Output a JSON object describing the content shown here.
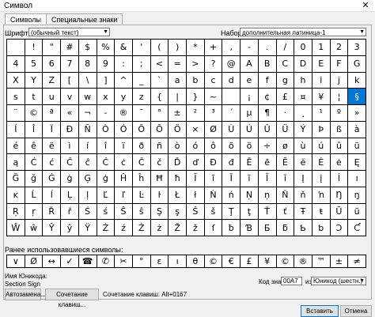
{
  "window": {
    "title": "Символ",
    "close_glyph": "✕"
  },
  "tabs": [
    {
      "label": "Символы"
    },
    {
      "label": "Специальные знаки"
    }
  ],
  "font": {
    "label": "Шрифт:",
    "value": "(обычный текст)"
  },
  "subset": {
    "label": "Набор:",
    "value": "дополнительная латиница-1"
  },
  "symbols": [
    [
      "",
      "!",
      "\"",
      "#",
      "$",
      "%",
      "&",
      "'",
      "(",
      ")",
      "*",
      "+",
      ",",
      "-",
      ".",
      "/",
      "0",
      "1",
      "2",
      "3"
    ],
    [
      "4",
      "5",
      "6",
      "7",
      "8",
      "9",
      ":",
      ";",
      "<",
      "=",
      ">",
      "?",
      "@",
      "A",
      "B",
      "C",
      "D",
      "E",
      "F",
      "G"
    ],
    [
      "X",
      "Y",
      "Z",
      "[",
      "\\",
      "]",
      "^",
      "_",
      "`",
      "a",
      "b",
      "c",
      "d",
      "e",
      "f",
      "g",
      "h",
      "i",
      "j",
      "k"
    ],
    [
      "s",
      "t",
      "u",
      "v",
      "w",
      "x",
      "y",
      "z",
      "{",
      "|",
      "}",
      "~",
      "",
      "¡",
      "¢",
      "£",
      "¤",
      "¥",
      "¦",
      "§"
    ],
    [
      "¨",
      "©",
      "ª",
      "«",
      "¬",
      "-",
      "®",
      "¯",
      "°",
      "±",
      "²",
      "³",
      "´",
      "µ",
      "¶",
      "·",
      "¸",
      "¹",
      "º",
      "»"
    ],
    [
      "Í",
      "Î",
      "Ï",
      "Ð",
      "Ñ",
      "Ò",
      "Ó",
      "Ô",
      "Õ",
      "Ö",
      "×",
      "Ø",
      "Ù",
      "Ú",
      "Û",
      "Ü",
      "Ý",
      "Þ",
      "ß",
      "à"
    ],
    [
      "é",
      "ê",
      "ë",
      "ì",
      "í",
      "î",
      "ï",
      "ð",
      "ñ",
      "ò",
      "ó",
      "ô",
      "õ",
      "ö",
      "÷",
      "ø",
      "ù",
      "ú",
      "û",
      "ü"
    ],
    [
      "ą",
      "Ć",
      "ć",
      "Ĉ",
      "ĉ",
      "Ċ",
      "ċ",
      "Č",
      "č",
      "Ď",
      "ď",
      "Đ",
      "đ",
      "Ē",
      "ē",
      "Ĕ",
      "ĕ",
      "Ė",
      "ė",
      "Ę"
    ],
    [
      "Ğ",
      "ğ",
      "Ġ",
      "ġ",
      "Ģ",
      "ģ",
      "Ĥ",
      "ĥ",
      "Ħ",
      "ħ",
      "Ĩ",
      "ĩ",
      "Ī",
      "ī",
      "Ĭ",
      "ĭ",
      "Į",
      "į",
      "İ",
      "ı"
    ],
    [
      "ĸ",
      "Ĺ",
      "ĺ",
      "Ļ",
      "ļ",
      "Ľ",
      "ľ",
      "Ŀ",
      "ŀ",
      "Ł",
      "ł",
      "Ń",
      "ń",
      "Ņ",
      "ņ",
      "Ň",
      "ň",
      "ŉ",
      "Ŋ",
      "ŋ"
    ],
    [
      "Ŗ",
      "ŗ",
      "Ř",
      "ř",
      "Ś",
      "ś",
      "Ŝ",
      "ŝ",
      "Ş",
      "ş",
      "Š",
      "š",
      "Ţ",
      "ţ",
      "Ť",
      "ť",
      "Ŧ",
      "ŧ",
      "Ũ",
      "ũ"
    ],
    [
      "Ŵ",
      "ŵ",
      "Ŷ",
      "ŷ",
      "Ÿ",
      "Ź",
      "ź",
      "Ż",
      "ż",
      "Ž",
      "ž",
      "ſ",
      "ƀ",
      "Ɓ",
      "Ƃ",
      "ƃ",
      "Ƅ",
      "ƅ",
      "Ɔ",
      "Ƈ"
    ]
  ],
  "selected_symbol": "§",
  "recent": {
    "label": "Ранее использовавшиеся символы:",
    "symbols": [
      "∨",
      "Ø",
      "↔",
      "✓",
      "☎",
      "✆",
      "✂",
      "°",
      "ε",
      "ı",
      "θ",
      "©",
      "€",
      "£",
      "¥",
      "©",
      "®",
      "™",
      "±",
      "≠"
    ]
  },
  "unicode_name": {
    "label": "Имя Юникода:",
    "value": "Section Sign"
  },
  "char_code": {
    "label": "Код знака:",
    "value": "00A7",
    "from_label": "из:",
    "from_value": "Юникод (шестн.)"
  },
  "buttons": {
    "autocorrect": "Автозамена...",
    "shortcut_key": "Сочетание клавиш...",
    "insert": "Вставить",
    "cancel": "Отмена"
  },
  "shortcut_text": "Сочетание клавиш: Alt+0167"
}
